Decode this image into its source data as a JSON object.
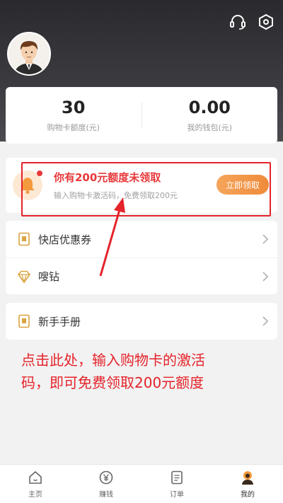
{
  "header": {
    "icons": [
      "headset-icon",
      "settings-icon"
    ]
  },
  "stats": [
    {
      "value": "30",
      "label": "购物卡额度(元)"
    },
    {
      "value": "0.00",
      "label": "我的钱包(元)"
    }
  ],
  "promo": {
    "title": "你有200元额度未领取",
    "subtitle": "输入购物卡激活码，免费领取200元",
    "button": "立即领取"
  },
  "menu_group_1": [
    {
      "label": "快店优惠券",
      "icon": "coupon-icon"
    },
    {
      "label": "嗖钻",
      "icon": "diamond-icon"
    }
  ],
  "menu_group_2": [
    {
      "label": "新手手册",
      "icon": "manual-icon"
    }
  ],
  "annotation": {
    "line1": "点击此处，输入购物卡的激活",
    "line2": "码，即可免费领取200元额度"
  },
  "tabs": [
    {
      "label": "主页",
      "icon": "home-icon"
    },
    {
      "label": "赚钱",
      "icon": "yen-icon"
    },
    {
      "label": "订单",
      "icon": "order-icon"
    },
    {
      "label": "我的",
      "icon": "profile-icon",
      "active": true
    }
  ],
  "colors": {
    "accent_red": "#e5232a",
    "button_orange": "#ef8a3a",
    "header_dark": "#2f2f33"
  }
}
